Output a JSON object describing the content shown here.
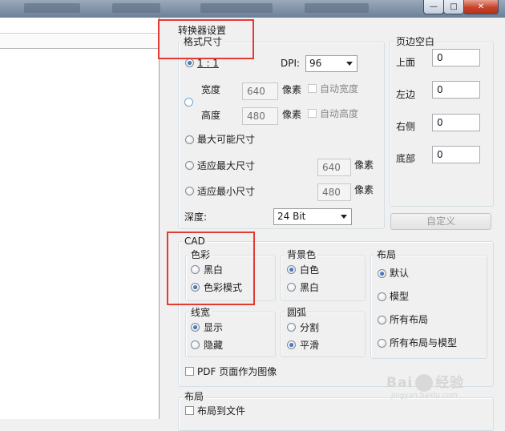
{
  "window": {
    "minimize": "—",
    "maximize": "□",
    "close": "✕"
  },
  "converter": {
    "title": "转换器设置",
    "format_group": "格式尺寸",
    "ratio_label": "1 : 1",
    "dpi_label": "DPI:",
    "dpi_value": "96",
    "width_label": "宽度",
    "width_value": "640",
    "width_unit": "像素",
    "auto_width": "自动宽度",
    "height_label": "高度",
    "height_value": "480",
    "height_unit": "像素",
    "auto_height": "自动高度",
    "max_size": "最大可能尺寸",
    "fit_max": "适应最大尺寸",
    "fit_max_value": "640",
    "fit_max_unit": "像素",
    "fit_min": "适应最小尺寸",
    "fit_min_value": "480",
    "fit_min_unit": "像素",
    "depth_label": "深度:",
    "depth_value": "24 Bit"
  },
  "margins": {
    "title": "页边空白",
    "top_label": "上面",
    "top_value": "0",
    "left_label": "左边",
    "left_value": "0",
    "right_label": "右侧",
    "right_value": "0",
    "bottom_label": "底部",
    "bottom_value": "0",
    "custom_button": "自定义"
  },
  "cad": {
    "title": "CAD",
    "color_group": "色彩",
    "bw": "黑白",
    "color_mode": "色彩模式",
    "bg_group": "背景色",
    "bg_white": "白色",
    "bg_black": "黑白",
    "layout_group": "布局",
    "default": "默认",
    "model": "模型",
    "all_layouts": "所有布局",
    "all_layouts_model": "所有布局与模型",
    "lineweight_group": "线宽",
    "show": "显示",
    "hide": "隐藏",
    "arc_group": "圆弧",
    "segmented": "分割",
    "smooth": "平滑",
    "pdf_as_image": "PDF 页面作为图像"
  },
  "layout_section": {
    "title": "布局",
    "layout_to_file": "布局到文件"
  },
  "watermark": {
    "left": "Bai",
    "right": "经验",
    "url": "jingyan.baidu.com"
  },
  "colors": {
    "highlight_box": "#e53935",
    "radio_selected": "#1c4f9a",
    "window_bg": "#f0f0f0"
  }
}
